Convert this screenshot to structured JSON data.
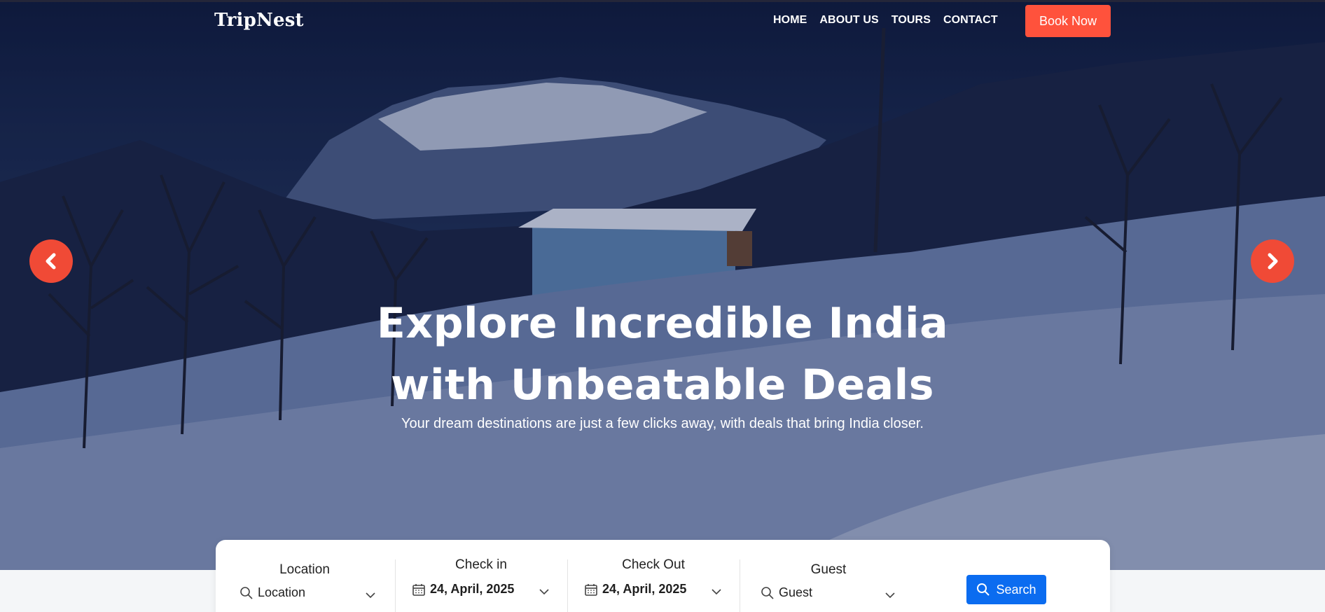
{
  "brand": {
    "logo": "TripNest"
  },
  "nav": {
    "items": [
      "HOME",
      "ABOUT US",
      "TOURS",
      "CONTACT"
    ],
    "book_label": "Book Now"
  },
  "hero": {
    "headline_line1": "Explore Incredible India",
    "headline_line2": "with Unbeatable Deals",
    "subheadline": "Your dream destinations are just a few clicks away, with deals that bring India closer."
  },
  "search": {
    "location": {
      "label": "Location",
      "value": "Location"
    },
    "checkin": {
      "label": "Check in",
      "value": "24, April, 2025"
    },
    "checkout": {
      "label": "Check Out",
      "value": "24, April, 2025"
    },
    "guest": {
      "label": "Guest",
      "value": "Guest"
    },
    "button_label": "Search"
  },
  "colors": {
    "accent": "#ff523c",
    "arrow": "#f04a36",
    "search_button": "#0b6cf0"
  },
  "icons": [
    "chevron-left-icon",
    "chevron-right-icon",
    "search-icon",
    "calendar-icon",
    "chevron-down-icon"
  ]
}
